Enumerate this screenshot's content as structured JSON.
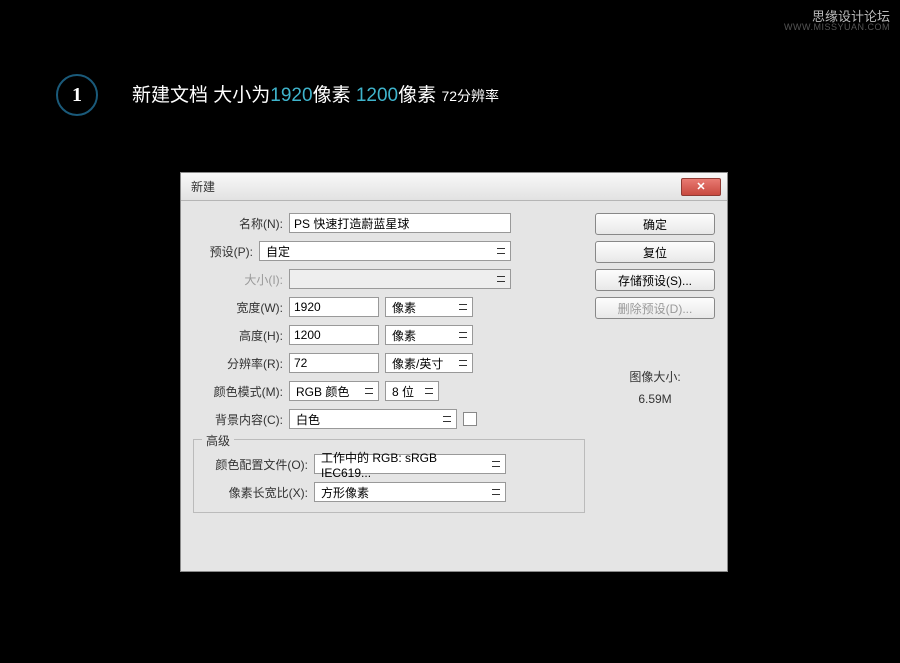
{
  "watermark": {
    "cn": "思缘设计论坛",
    "en": "WWW.MISSYUAN.COM"
  },
  "step": {
    "number": "1",
    "text_prefix": "新建文档 大小为",
    "width_val": "1920",
    "width_unit": "像素",
    "height_val": "1200",
    "height_unit": "像素",
    "resolution_text": "72分辨率"
  },
  "dialog": {
    "title": "新建",
    "labels": {
      "name": "名称(N):",
      "preset": "预设(P):",
      "size": "大小(I):",
      "width": "宽度(W):",
      "height": "高度(H):",
      "resolution": "分辨率(R):",
      "color_mode": "颜色模式(M):",
      "background": "背景内容(C):",
      "advanced": "高级",
      "color_profile": "颜色配置文件(O):",
      "pixel_aspect": "像素长宽比(X):",
      "image_size": "图像大小:"
    },
    "values": {
      "name": "PS 快速打造蔚蓝星球",
      "preset": "自定",
      "size": "",
      "width": "1920",
      "width_unit": "像素",
      "height": "1200",
      "height_unit": "像素",
      "resolution": "72",
      "resolution_unit": "像素/英寸",
      "color_mode": "RGB 颜色",
      "color_depth": "8 位",
      "background": "白色",
      "color_profile": "工作中的 RGB: sRGB IEC619...",
      "pixel_aspect": "方形像素",
      "image_size_value": "6.59M"
    },
    "buttons": {
      "ok": "确定",
      "reset": "复位",
      "save_preset": "存储预设(S)...",
      "delete_preset": "删除预设(D)...",
      "close": "✕"
    }
  }
}
